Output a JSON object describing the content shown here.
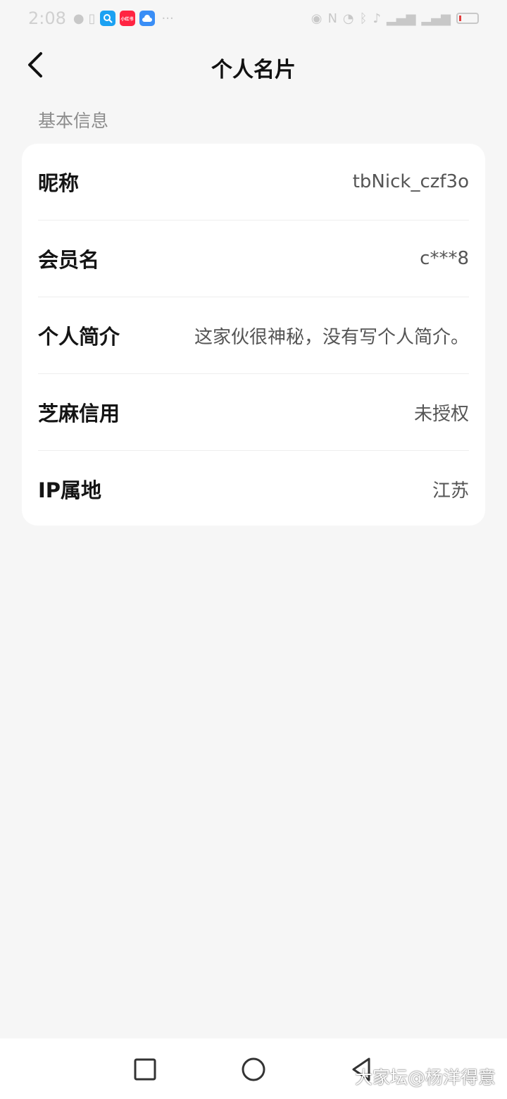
{
  "status_bar": {
    "time": "2:08",
    "app_icons": [
      {
        "name": "search-app-icon",
        "color": "#1ba1f2"
      },
      {
        "name": "xiaohongshu-app-icon",
        "color": "#ff2442",
        "text": "小红书"
      },
      {
        "name": "cloud-app-icon",
        "color": "#3a8ef6"
      }
    ]
  },
  "nav": {
    "title": "个人名片"
  },
  "section": {
    "label": "基本信息"
  },
  "rows": [
    {
      "label": "昵称",
      "value": "tbNick_czf3o"
    },
    {
      "label": "会员名",
      "value": "c***8"
    },
    {
      "label": "个人简介",
      "value": "这家伙很神秘，没有写个人简介。"
    },
    {
      "label": "芝麻信用",
      "value": "未授权"
    },
    {
      "label": "IP属地",
      "value": "江苏"
    }
  ],
  "watermark": "大家坛@杨洋得意"
}
